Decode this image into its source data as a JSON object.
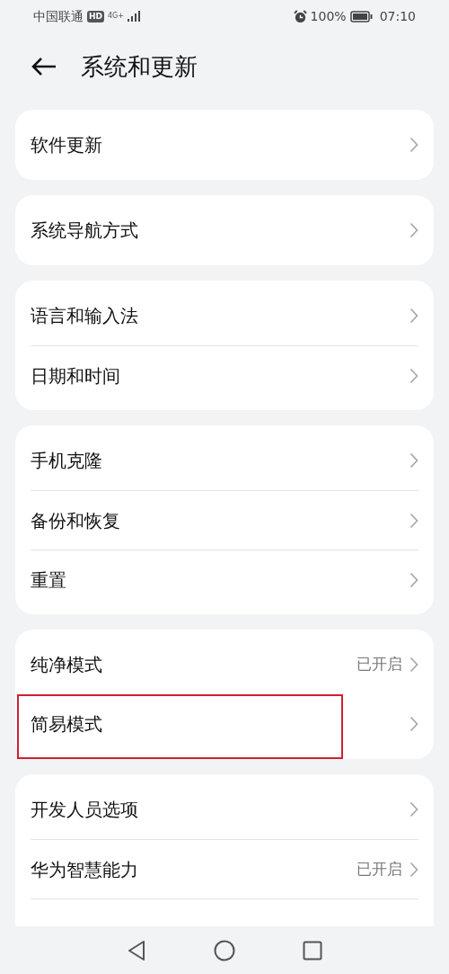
{
  "status_bar": {
    "carrier": "中国联通",
    "hd": "HD",
    "network": "4G+",
    "battery": "100%",
    "time": "07:10"
  },
  "header": {
    "title": "系统和更新"
  },
  "groups": [
    {
      "items": [
        {
          "label": "软件更新",
          "highlighted": false
        }
      ]
    },
    {
      "items": [
        {
          "label": "系统导航方式",
          "highlighted": false
        }
      ]
    },
    {
      "items": [
        {
          "label": "语言和输入法",
          "highlighted": false
        },
        {
          "label": "日期和时间",
          "highlighted": false
        }
      ]
    },
    {
      "items": [
        {
          "label": "手机克隆",
          "highlighted": false
        },
        {
          "label": "备份和恢复",
          "highlighted": false
        },
        {
          "label": "重置",
          "highlighted": false
        }
      ]
    },
    {
      "items": [
        {
          "label": "纯净模式",
          "value": "已开启",
          "highlighted": false
        },
        {
          "label": "简易模式",
          "highlighted": true
        }
      ]
    },
    {
      "items": [
        {
          "label": "开发人员选项",
          "highlighted": false
        },
        {
          "label": "华为智慧能力",
          "value": "已开启",
          "highlighted": false
        }
      ],
      "continues": true
    }
  ]
}
